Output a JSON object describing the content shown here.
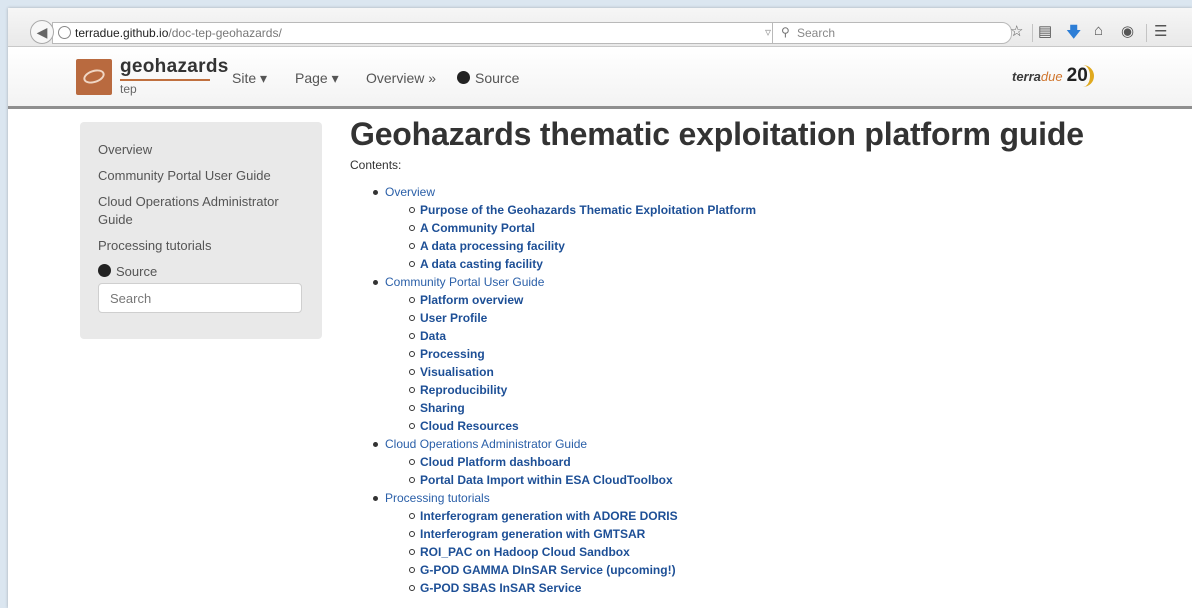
{
  "browser": {
    "url_host": "terradue.github.io",
    "url_path": "/doc-tep-geohazards/",
    "url_controls": "▿ C",
    "search_placeholder": "Search"
  },
  "navbar": {
    "brand_name": "geohazards",
    "brand_sub": "tep",
    "links": [
      "Site ▾",
      "Page ▾",
      "Overview »",
      "Source"
    ],
    "partner_logo_text": "terra",
    "partner_logo_text2": "due",
    "partner_logo_badge": "20"
  },
  "sidebar": {
    "items": [
      "Overview",
      "Community Portal User Guide",
      "Cloud Operations Administrator Guide",
      "Processing tutorials",
      "Source"
    ],
    "search_placeholder": "Search"
  },
  "main": {
    "title": "Geohazards thematic exploitation platform guide",
    "contents_label": "Contents:",
    "toc": [
      {
        "label": "Overview",
        "children": [
          "Purpose of the Geohazards Thematic Exploitation Platform",
          "A Community Portal",
          "A data processing facility",
          "A data casting facility"
        ]
      },
      {
        "label": "Community Portal User Guide",
        "children": [
          "Platform overview",
          "User Profile",
          "Data",
          "Processing",
          "Visualisation",
          "Reproducibility",
          "Sharing",
          "Cloud Resources"
        ]
      },
      {
        "label": "Cloud Operations Administrator Guide",
        "children": [
          "Cloud Platform dashboard",
          "Portal Data Import within ESA CloudToolbox"
        ]
      },
      {
        "label": "Processing tutorials",
        "children": [
          "Interferogram generation with ADORE DORIS",
          "Interferogram generation with GMTSAR",
          "ROI_PAC on Hadoop Cloud Sandbox",
          "G-POD GAMMA DInSAR Service (upcoming!)",
          "G-POD SBAS InSAR Service"
        ]
      }
    ]
  }
}
